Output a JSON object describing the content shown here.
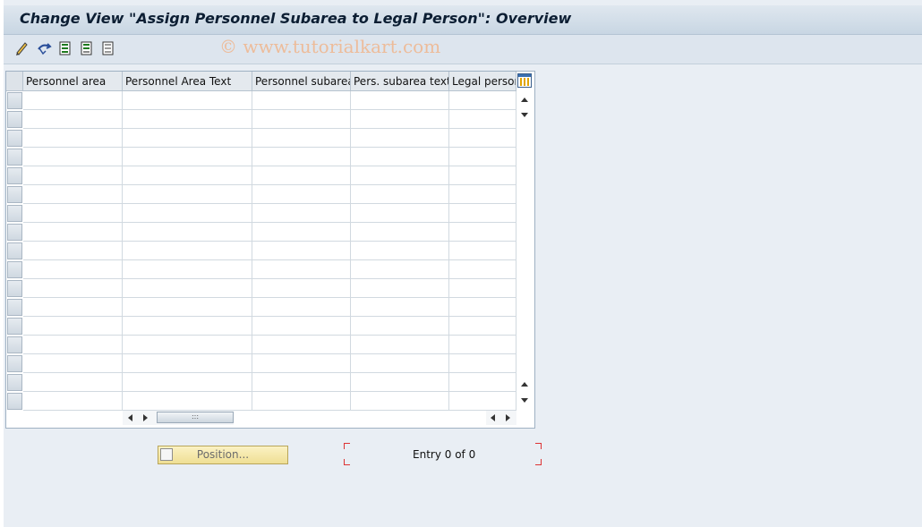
{
  "window": {
    "title": "Change View \"Assign Personnel Subarea to Legal Person\": Overview"
  },
  "watermark": "© www.tutorialkart.com",
  "toolbar": {
    "buttons": [
      {
        "name": "change-display-icon"
      },
      {
        "name": "undo-icon"
      },
      {
        "name": "select-all-icon"
      },
      {
        "name": "select-block-icon"
      },
      {
        "name": "deselect-all-icon"
      }
    ]
  },
  "table": {
    "columns": [
      "Personnel area",
      "Personnel Area Text",
      "Personnel subarea",
      "Pers. subarea text",
      "Legal person"
    ],
    "rows": [],
    "visible_row_count": 17
  },
  "footer": {
    "position_button_label": "Position...",
    "entry_text": "Entry 0 of 0"
  }
}
